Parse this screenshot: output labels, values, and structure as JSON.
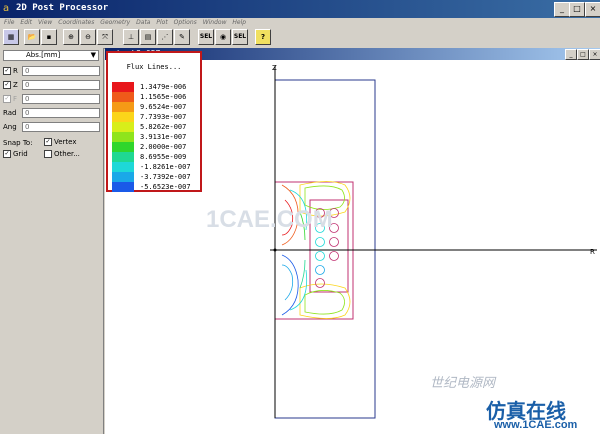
{
  "window": {
    "title": "2D Post Processor",
    "app_icon": "a"
  },
  "menu": [
    "File",
    "Edit",
    "View",
    "Coordinates",
    "Geometry",
    "Data",
    "Plot",
    "Options",
    "Window",
    "Help"
  ],
  "toolbar": {
    "sel1": "SEL",
    "sel2": "SEL",
    "help": "?"
  },
  "panel": {
    "coord_label": "Abs.[mm]",
    "r_label": "R",
    "r_value": "0",
    "z_label": "Z",
    "z_value": "0",
    "f_label": "F",
    "f_value": "0",
    "rad_label": "Rad",
    "rad_value": "0",
    "ang_label": "Ang",
    "ang_value": "0",
    "snap_label": "Snap To:",
    "vertex_label": "Vertex",
    "grid_label": "Grid",
    "other_label": "Other..."
  },
  "document": {
    "title": "buck2_057"
  },
  "axes": {
    "z": "Z",
    "r": "R"
  },
  "legend": {
    "title": "Flux Lines...",
    "entries": [
      {
        "value": "1.3479e-006",
        "color": "#e8171b"
      },
      {
        "value": "1.1565e-006",
        "color": "#ef5a1a"
      },
      {
        "value": "9.6524e-007",
        "color": "#f59a16"
      },
      {
        "value": "7.7393e-007",
        "color": "#fbd51a"
      },
      {
        "value": "5.8262e-007",
        "color": "#d8ee1a"
      },
      {
        "value": "3.9131e-007",
        "color": "#8fe41c"
      },
      {
        "value": "2.0000e-007",
        "color": "#2fd62c"
      },
      {
        "value": "8.6955e-009",
        "color": "#1fd892"
      },
      {
        "value": "-1.8261e-007",
        "color": "#1ed8d8"
      },
      {
        "value": "-3.7392e-007",
        "color": "#1aa8e8"
      },
      {
        "value": "-5.6523e-007",
        "color": "#1a5ae8"
      }
    ]
  },
  "watermarks": {
    "w1": "1CAE.COM",
    "w2": "世纪电源网",
    "w3": "仿真在线",
    "w4": "www.1CAE.com"
  }
}
